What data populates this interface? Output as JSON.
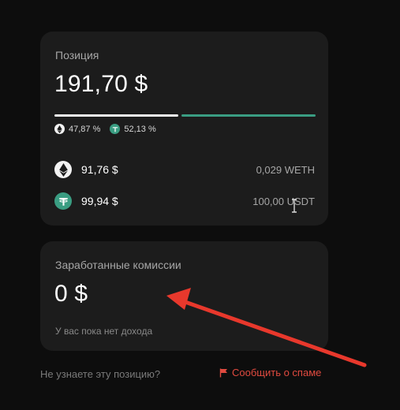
{
  "position_card": {
    "title": "Позиция",
    "total_value": "191,70 $",
    "eth_share": 0.4787,
    "usdt_share": 0.5213,
    "eth_pct_label": "47,87 %",
    "usdt_pct_label": "52,13 %",
    "assets": [
      {
        "icon": "eth-icon",
        "usd_value": "91,76 $",
        "quantity": "0,029 WETH"
      },
      {
        "icon": "usdt-icon",
        "usd_value": "99,94 $",
        "quantity": "100,00 USDT"
      }
    ]
  },
  "fees_card": {
    "title": "Заработанные комиссии",
    "value": "0 $",
    "subtitle": "У вас пока нет дохода"
  },
  "footer": {
    "unknown_position_text": "Не узнаете эту позицию?",
    "report_spam_label": "Сообщить о спаме"
  },
  "colors": {
    "background": "#0d0d0d",
    "card": "#1c1c1c",
    "eth_bar": "#f2f2f2",
    "usdt_accent": "#3a9d82",
    "report_red": "#e04a3f",
    "annotation_arrow": "#e8382c"
  }
}
